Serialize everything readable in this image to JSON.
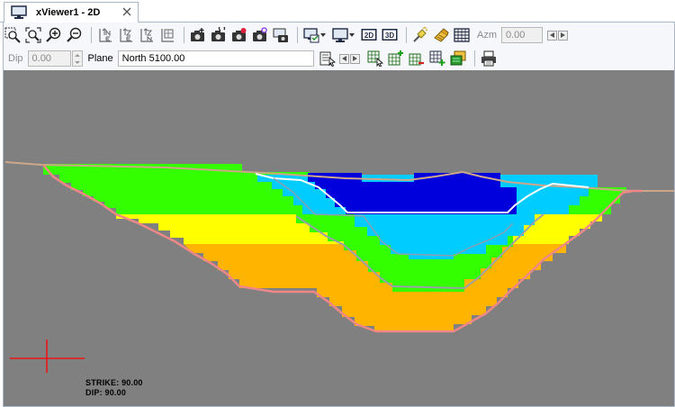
{
  "tab": {
    "label": "xViewer1 - 2D",
    "icon": "monitor-icon"
  },
  "toolbar1": {
    "view_icons": [
      "zoom-window-icon",
      "zoom-extents-icon",
      "zoom-in-icon",
      "zoom-out-icon"
    ],
    "section_icons": [
      "section-ne-icon",
      "section-ze-icon",
      "section-zn-icon",
      "section-plan-icon"
    ],
    "camera_icons": [
      "camera-add-icon",
      "camera-refresh-icon",
      "camera-record-icon",
      "camera-settings-icon",
      "camera-screen-icon"
    ],
    "display_icons": [
      "display-options-icon",
      "monitor-settings-icon"
    ],
    "mode_2d": "2D",
    "mode_3d": "3D",
    "tool_icons": [
      "light-icon",
      "eraser-icon",
      "grid-icon"
    ],
    "azm_label": "Azm",
    "azm_value": "0.00"
  },
  "toolbar2": {
    "dip_label": "Dip",
    "dip_value": "0.00",
    "plane_label": "Plane",
    "plane_value": "North 5100.00",
    "grid_icons": [
      "select-grid-icon",
      "grid-add-icon",
      "grid-remove-icon",
      "grid-plus-icon",
      "layers-icon"
    ],
    "print_icon": "printer-icon"
  },
  "viewport": {
    "background": "#808080",
    "strike_text": "STRIKE: 90.00",
    "dip_text": "DIP: 90.00",
    "colors": {
      "green": "#33ff00",
      "yellow": "#ffff00",
      "orange": "#ffb400",
      "cyan": "#00ccff",
      "blue": "#0000dd",
      "pink": "#ee8888",
      "tan": "#cda788",
      "crosshair": "#ff0000"
    }
  }
}
